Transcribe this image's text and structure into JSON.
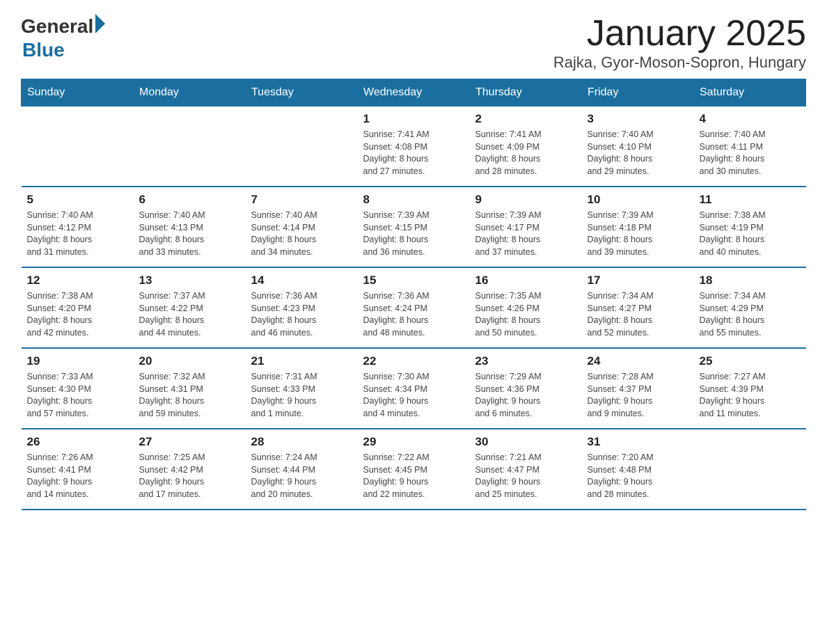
{
  "logo": {
    "general": "General",
    "blue": "Blue"
  },
  "title": "January 2025",
  "subtitle": "Rajka, Gyor-Moson-Sopron, Hungary",
  "weekdays": [
    "Sunday",
    "Monday",
    "Tuesday",
    "Wednesday",
    "Thursday",
    "Friday",
    "Saturday"
  ],
  "weeks": [
    [
      {
        "day": "",
        "info": ""
      },
      {
        "day": "",
        "info": ""
      },
      {
        "day": "",
        "info": ""
      },
      {
        "day": "1",
        "info": "Sunrise: 7:41 AM\nSunset: 4:08 PM\nDaylight: 8 hours\nand 27 minutes."
      },
      {
        "day": "2",
        "info": "Sunrise: 7:41 AM\nSunset: 4:09 PM\nDaylight: 8 hours\nand 28 minutes."
      },
      {
        "day": "3",
        "info": "Sunrise: 7:40 AM\nSunset: 4:10 PM\nDaylight: 8 hours\nand 29 minutes."
      },
      {
        "day": "4",
        "info": "Sunrise: 7:40 AM\nSunset: 4:11 PM\nDaylight: 8 hours\nand 30 minutes."
      }
    ],
    [
      {
        "day": "5",
        "info": "Sunrise: 7:40 AM\nSunset: 4:12 PM\nDaylight: 8 hours\nand 31 minutes."
      },
      {
        "day": "6",
        "info": "Sunrise: 7:40 AM\nSunset: 4:13 PM\nDaylight: 8 hours\nand 33 minutes."
      },
      {
        "day": "7",
        "info": "Sunrise: 7:40 AM\nSunset: 4:14 PM\nDaylight: 8 hours\nand 34 minutes."
      },
      {
        "day": "8",
        "info": "Sunrise: 7:39 AM\nSunset: 4:15 PM\nDaylight: 8 hours\nand 36 minutes."
      },
      {
        "day": "9",
        "info": "Sunrise: 7:39 AM\nSunset: 4:17 PM\nDaylight: 8 hours\nand 37 minutes."
      },
      {
        "day": "10",
        "info": "Sunrise: 7:39 AM\nSunset: 4:18 PM\nDaylight: 8 hours\nand 39 minutes."
      },
      {
        "day": "11",
        "info": "Sunrise: 7:38 AM\nSunset: 4:19 PM\nDaylight: 8 hours\nand 40 minutes."
      }
    ],
    [
      {
        "day": "12",
        "info": "Sunrise: 7:38 AM\nSunset: 4:20 PM\nDaylight: 8 hours\nand 42 minutes."
      },
      {
        "day": "13",
        "info": "Sunrise: 7:37 AM\nSunset: 4:22 PM\nDaylight: 8 hours\nand 44 minutes."
      },
      {
        "day": "14",
        "info": "Sunrise: 7:36 AM\nSunset: 4:23 PM\nDaylight: 8 hours\nand 46 minutes."
      },
      {
        "day": "15",
        "info": "Sunrise: 7:36 AM\nSunset: 4:24 PM\nDaylight: 8 hours\nand 48 minutes."
      },
      {
        "day": "16",
        "info": "Sunrise: 7:35 AM\nSunset: 4:26 PM\nDaylight: 8 hours\nand 50 minutes."
      },
      {
        "day": "17",
        "info": "Sunrise: 7:34 AM\nSunset: 4:27 PM\nDaylight: 8 hours\nand 52 minutes."
      },
      {
        "day": "18",
        "info": "Sunrise: 7:34 AM\nSunset: 4:29 PM\nDaylight: 8 hours\nand 55 minutes."
      }
    ],
    [
      {
        "day": "19",
        "info": "Sunrise: 7:33 AM\nSunset: 4:30 PM\nDaylight: 8 hours\nand 57 minutes."
      },
      {
        "day": "20",
        "info": "Sunrise: 7:32 AM\nSunset: 4:31 PM\nDaylight: 8 hours\nand 59 minutes."
      },
      {
        "day": "21",
        "info": "Sunrise: 7:31 AM\nSunset: 4:33 PM\nDaylight: 9 hours\nand 1 minute."
      },
      {
        "day": "22",
        "info": "Sunrise: 7:30 AM\nSunset: 4:34 PM\nDaylight: 9 hours\nand 4 minutes."
      },
      {
        "day": "23",
        "info": "Sunrise: 7:29 AM\nSunset: 4:36 PM\nDaylight: 9 hours\nand 6 minutes."
      },
      {
        "day": "24",
        "info": "Sunrise: 7:28 AM\nSunset: 4:37 PM\nDaylight: 9 hours\nand 9 minutes."
      },
      {
        "day": "25",
        "info": "Sunrise: 7:27 AM\nSunset: 4:39 PM\nDaylight: 9 hours\nand 11 minutes."
      }
    ],
    [
      {
        "day": "26",
        "info": "Sunrise: 7:26 AM\nSunset: 4:41 PM\nDaylight: 9 hours\nand 14 minutes."
      },
      {
        "day": "27",
        "info": "Sunrise: 7:25 AM\nSunset: 4:42 PM\nDaylight: 9 hours\nand 17 minutes."
      },
      {
        "day": "28",
        "info": "Sunrise: 7:24 AM\nSunset: 4:44 PM\nDaylight: 9 hours\nand 20 minutes."
      },
      {
        "day": "29",
        "info": "Sunrise: 7:22 AM\nSunset: 4:45 PM\nDaylight: 9 hours\nand 22 minutes."
      },
      {
        "day": "30",
        "info": "Sunrise: 7:21 AM\nSunset: 4:47 PM\nDaylight: 9 hours\nand 25 minutes."
      },
      {
        "day": "31",
        "info": "Sunrise: 7:20 AM\nSunset: 4:48 PM\nDaylight: 9 hours\nand 28 minutes."
      },
      {
        "day": "",
        "info": ""
      }
    ]
  ]
}
